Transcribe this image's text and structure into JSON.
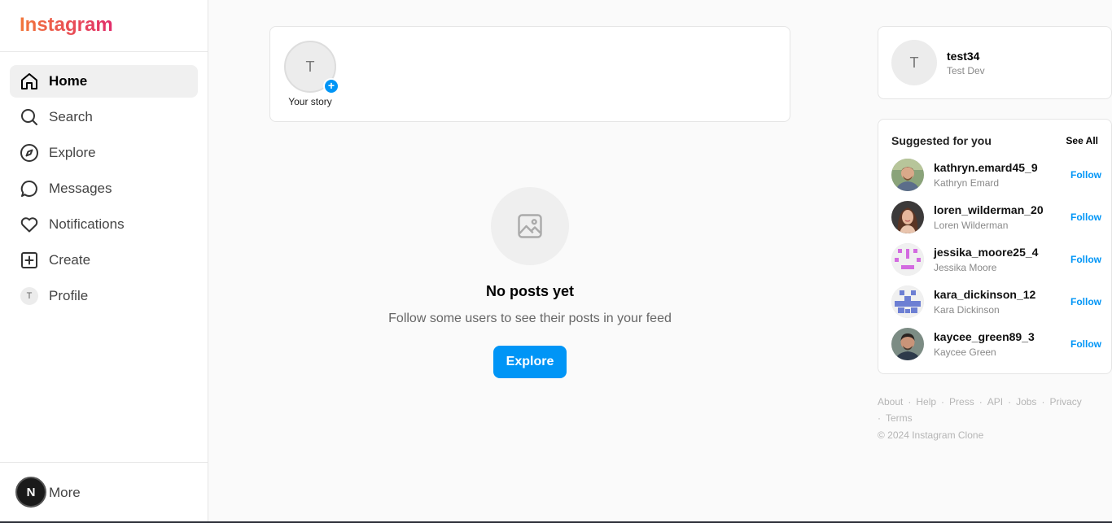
{
  "app": {
    "logo": "Instagram"
  },
  "sidebar": {
    "items": [
      {
        "label": "Home",
        "icon": "home-icon",
        "active": true
      },
      {
        "label": "Search",
        "icon": "search-icon"
      },
      {
        "label": "Explore",
        "icon": "compass-icon"
      },
      {
        "label": "Messages",
        "icon": "message-icon"
      },
      {
        "label": "Notifications",
        "icon": "heart-icon"
      },
      {
        "label": "Create",
        "icon": "plus-square-icon"
      },
      {
        "label": "Profile",
        "icon": "avatar",
        "avatar_initial": "T"
      }
    ],
    "more": {
      "label": "More",
      "badge": "N"
    }
  },
  "stories": {
    "own": {
      "initial": "T",
      "label": "Your story",
      "plus": "+"
    }
  },
  "feed": {
    "empty_title": "No posts yet",
    "empty_subtitle": "Follow some users to see their posts in your feed",
    "explore_button": "Explore"
  },
  "current_user": {
    "initial": "T",
    "username": "test34",
    "name": "Test Dev"
  },
  "suggestions": {
    "title": "Suggested for you",
    "see_all": "See All",
    "follow_label": "Follow",
    "users": [
      {
        "username": "kathryn.emard45_9",
        "name": "Kathryn Emard",
        "avatar": "photo-man-beard"
      },
      {
        "username": "loren_wilderman_20",
        "name": "Loren Wilderman",
        "avatar": "photo-woman"
      },
      {
        "username": "jessika_moore25_4",
        "name": "Jessika Moore",
        "avatar": "identicon-pink"
      },
      {
        "username": "kara_dickinson_12",
        "name": "Kara Dickinson",
        "avatar": "identicon-blue"
      },
      {
        "username": "kaycee_green89_3",
        "name": "Kaycee Green",
        "avatar": "photo-man"
      }
    ]
  },
  "footer": {
    "links": [
      "About",
      "Help",
      "Press",
      "API",
      "Jobs",
      "Privacy",
      "Terms"
    ],
    "copyright": "© 2024 Instagram Clone"
  },
  "colors": {
    "accent": "#0095f6",
    "logo_start": "#f2773a",
    "logo_end": "#e12d6b"
  }
}
